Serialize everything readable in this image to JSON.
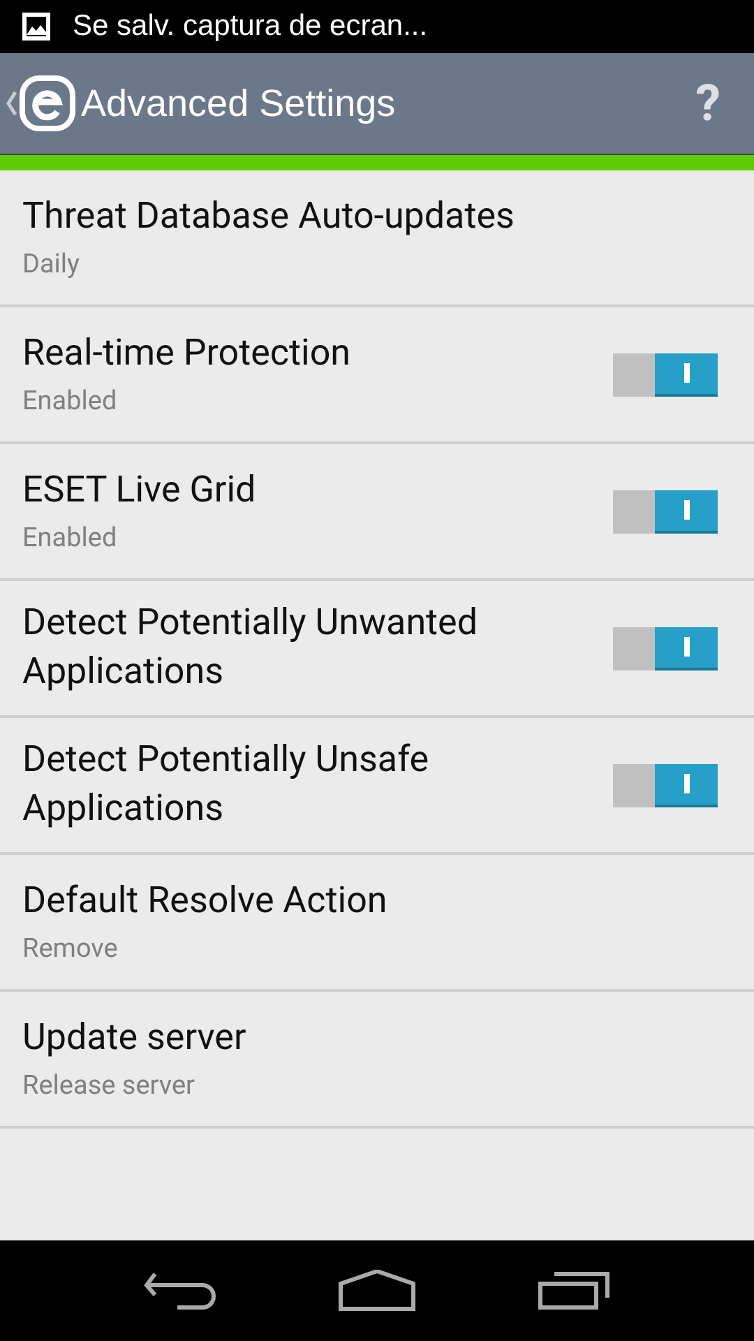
{
  "status_bar": {
    "notification": "Se salv. captura de ecran..."
  },
  "action_bar": {
    "title": "Advanced Settings",
    "help": "?"
  },
  "settings": [
    {
      "kind": "value",
      "title": "Threat Database Auto-updates",
      "summary": "Daily"
    },
    {
      "kind": "toggle",
      "title": "Real-time Protection",
      "summary": "Enabled",
      "on": true
    },
    {
      "kind": "toggle",
      "title": "ESET Live Grid",
      "summary": "Enabled",
      "on": true
    },
    {
      "kind": "toggle",
      "title": "Detect Potentially Unwanted Applications",
      "on": true
    },
    {
      "kind": "toggle",
      "title": "Detect Potentially Unsafe Applications",
      "on": true
    },
    {
      "kind": "value",
      "title": "Default Resolve Action",
      "summary": "Remove"
    },
    {
      "kind": "value",
      "title": "Update server",
      "summary": "Release server"
    }
  ]
}
